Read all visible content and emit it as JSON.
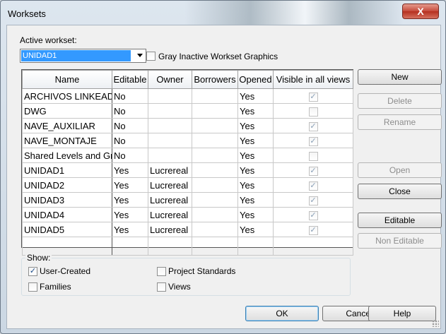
{
  "dialog": {
    "title": "Worksets",
    "close_glyph": "X"
  },
  "active_workset": {
    "label": "Active workset:",
    "selected": "UNIDAD1"
  },
  "gray_inactive": {
    "label": "Gray Inactive Workset Graphics",
    "checked": false
  },
  "table": {
    "columns": [
      "Name",
      "Editable",
      "Owner",
      "Borrowers",
      "Opened",
      "Visible in all views"
    ],
    "rows": [
      {
        "name": "ARCHIVOS LINKEADO",
        "editable": "No",
        "owner": "",
        "borrowers": "",
        "opened": "Yes",
        "visible": true
      },
      {
        "name": "DWG",
        "editable": "No",
        "owner": "",
        "borrowers": "",
        "opened": "Yes",
        "visible": false
      },
      {
        "name": "NAVE_AUXILIAR",
        "editable": "No",
        "owner": "",
        "borrowers": "",
        "opened": "Yes",
        "visible": true
      },
      {
        "name": "NAVE_MONTAJE",
        "editable": "No",
        "owner": "",
        "borrowers": "",
        "opened": "Yes",
        "visible": true
      },
      {
        "name": "Shared Levels and Gri",
        "editable": "No",
        "owner": "",
        "borrowers": "",
        "opened": "Yes",
        "visible": false
      },
      {
        "name": "UNIDAD1",
        "editable": "Yes",
        "owner": "Lucrereal",
        "borrowers": "",
        "opened": "Yes",
        "visible": true
      },
      {
        "name": "UNIDAD2",
        "editable": "Yes",
        "owner": "Lucrereal",
        "borrowers": "",
        "opened": "Yes",
        "visible": true
      },
      {
        "name": "UNIDAD3",
        "editable": "Yes",
        "owner": "Lucrereal",
        "borrowers": "",
        "opened": "Yes",
        "visible": true
      },
      {
        "name": "UNIDAD4",
        "editable": "Yes",
        "owner": "Lucrereal",
        "borrowers": "",
        "opened": "Yes",
        "visible": true
      },
      {
        "name": "UNIDAD5",
        "editable": "Yes",
        "owner": "Lucrereal",
        "borrowers": "",
        "opened": "Yes",
        "visible": true
      }
    ]
  },
  "side_buttons": {
    "new": "New",
    "delete": "Delete",
    "rename": "Rename",
    "open": "Open",
    "close": "Close",
    "editable": "Editable",
    "non_editable": "Non Editable"
  },
  "show": {
    "label": "Show:",
    "user_created": {
      "label": "User-Created",
      "checked": true
    },
    "families": {
      "label": "Families",
      "checked": false
    },
    "project_standards": {
      "label": "Project Standards",
      "checked": false
    },
    "views": {
      "label": "Views",
      "checked": false
    }
  },
  "footer": {
    "ok": "OK",
    "cancel": "Cancel",
    "help": "Help"
  },
  "icons": {
    "check": "✓",
    "dropdown": "chevron-down-icon"
  }
}
